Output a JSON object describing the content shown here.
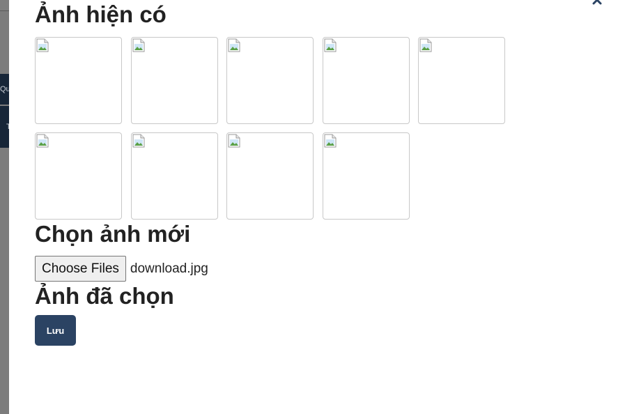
{
  "modal": {
    "existing_title": "Ảnh hiện có",
    "existing_images": [
      {
        "name": "existing-image"
      },
      {
        "name": "existing-image"
      },
      {
        "name": "existing-image"
      },
      {
        "name": "existing-image"
      },
      {
        "name": "existing-image"
      },
      {
        "name": "existing-image"
      },
      {
        "name": "existing-image"
      },
      {
        "name": "existing-image"
      },
      {
        "name": "existing-image"
      }
    ],
    "new_title": "Chọn ảnh mới",
    "file_button_label": "Choose Files",
    "file_name": "download.jpg",
    "selected_title": "Ảnh đã chọn",
    "save_label": "Lưu",
    "close_icon": "close-icon"
  },
  "backdrop": {
    "nav_item_1": "Qu",
    "nav_item_2": "T"
  },
  "colors": {
    "primary_button": "#2b4363",
    "sidebar_nav": "#172638",
    "overlay": "#7f7f7f"
  }
}
